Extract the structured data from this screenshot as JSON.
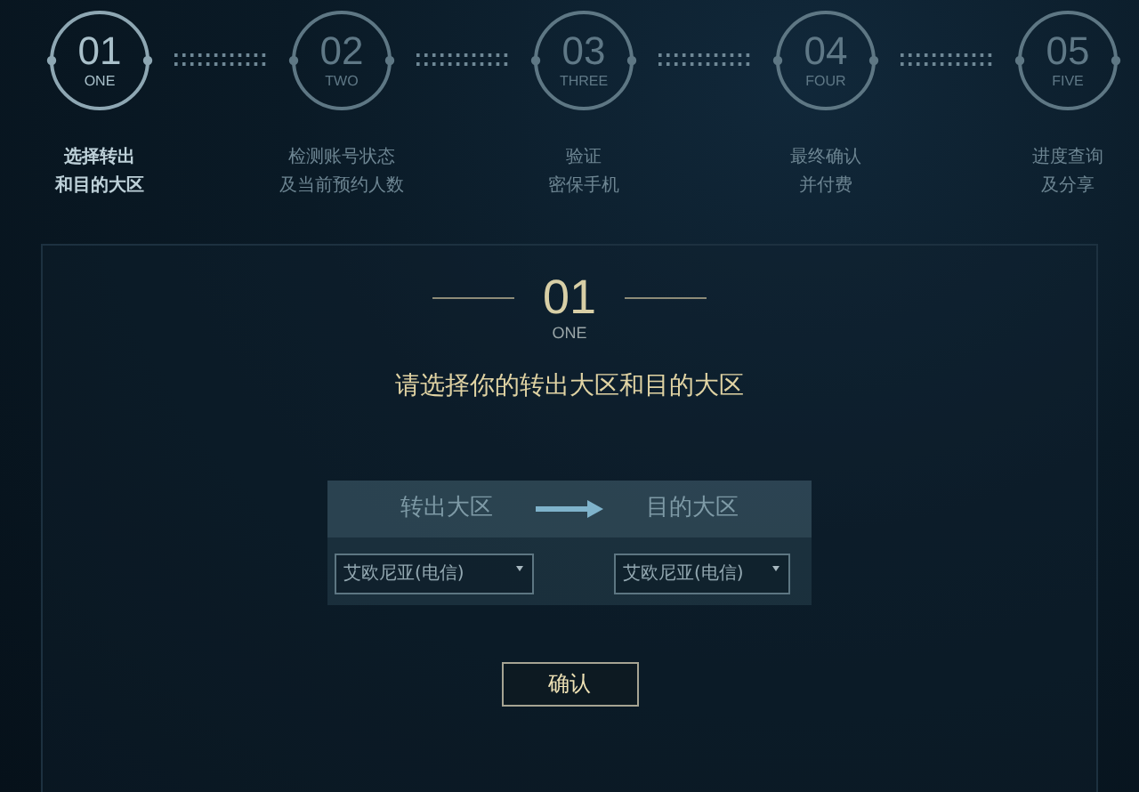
{
  "steps": [
    {
      "number": "01",
      "word": "ONE",
      "label_lines": [
        "选择转出",
        "和目的大区"
      ],
      "selected": true
    },
    {
      "number": "02",
      "word": "TWO",
      "label_lines": [
        "检测账号状态",
        "及当前预约人数"
      ],
      "selected": false
    },
    {
      "number": "03",
      "word": "THREE",
      "label_lines": [
        "验证",
        "密保手机"
      ],
      "selected": false
    },
    {
      "number": "04",
      "word": "FOUR",
      "label_lines": [
        "最终确认",
        "并付费"
      ],
      "selected": false
    },
    {
      "number": "05",
      "word": "FIVE",
      "label_lines": [
        "进度查询",
        "及分享"
      ],
      "selected": false
    }
  ],
  "current_step": {
    "number": "01",
    "word": "ONE",
    "title": "请选择你的转出大区和目的大区"
  },
  "transfer": {
    "from_label": "转出大区",
    "to_label": "目的大区",
    "from_value": "艾欧尼亚(电信)",
    "to_value": "艾欧尼亚(电信)"
  },
  "confirm_button": "确认"
}
